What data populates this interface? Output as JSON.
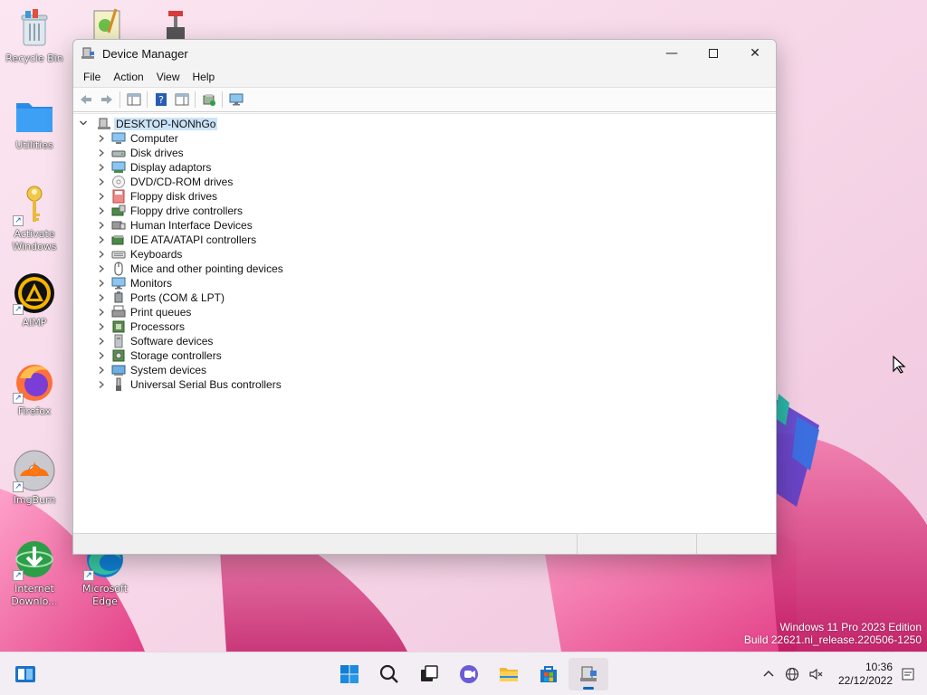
{
  "desktop": {
    "icons": [
      {
        "label": "Recycle Bin"
      },
      {
        "label": "Utilities"
      },
      {
        "label": "Activate Windows"
      },
      {
        "label": "AIMP"
      },
      {
        "label": "Firefox"
      },
      {
        "label": "ImgBurn"
      },
      {
        "label": "Internet Downlo..."
      },
      {
        "label": "Microsoft Edge"
      }
    ]
  },
  "window": {
    "title": "Device Manager",
    "menu": [
      "File",
      "Action",
      "View",
      "Help"
    ],
    "root": "DESKTOP-NONhGo",
    "categories": [
      {
        "label": "Computer",
        "icon": "computer-icon"
      },
      {
        "label": "Disk drives",
        "icon": "disk-drive-icon"
      },
      {
        "label": "Display adaptors",
        "icon": "display-adapter-icon"
      },
      {
        "label": "DVD/CD-ROM drives",
        "icon": "dvd-icon"
      },
      {
        "label": "Floppy disk drives",
        "icon": "floppy-disk-icon"
      },
      {
        "label": "Floppy drive controllers",
        "icon": "floppy-controller-icon"
      },
      {
        "label": "Human Interface Devices",
        "icon": "hid-icon"
      },
      {
        "label": "IDE ATA/ATAPI controllers",
        "icon": "ide-controller-icon"
      },
      {
        "label": "Keyboards",
        "icon": "keyboard-icon"
      },
      {
        "label": "Mice and other pointing devices",
        "icon": "mouse-icon"
      },
      {
        "label": "Monitors",
        "icon": "monitor-icon"
      },
      {
        "label": "Ports (COM & LPT)",
        "icon": "port-icon"
      },
      {
        "label": "Print queues",
        "icon": "printer-icon"
      },
      {
        "label": "Processors",
        "icon": "processor-icon"
      },
      {
        "label": "Software devices",
        "icon": "software-device-icon"
      },
      {
        "label": "Storage controllers",
        "icon": "storage-controller-icon"
      },
      {
        "label": "System devices",
        "icon": "system-device-icon"
      },
      {
        "label": "Universal Serial Bus controllers",
        "icon": "usb-icon"
      }
    ]
  },
  "watermark": {
    "line1": "Windows 11 Pro 2023 Edition",
    "line2": "Build 22621.ni_release.220506-1250"
  },
  "taskbar": {
    "time": "10:36",
    "date": "22/12/2022",
    "accent": "#0067c0"
  }
}
